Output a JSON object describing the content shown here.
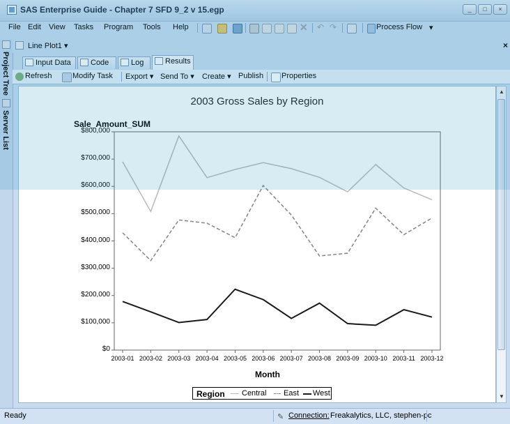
{
  "window": {
    "title": "SAS Enterprise Guide - Chapter 7 SFD 9_2 v 15.egp"
  },
  "menu": {
    "items": [
      "File",
      "Edit",
      "View",
      "Tasks",
      "Program",
      "Tools",
      "Help"
    ],
    "process_flow": "Process Flow"
  },
  "left_rail": {
    "project_tree": "Project Tree",
    "server_list": "Server List"
  },
  "document": {
    "title": "Line Plot1 ▾",
    "close": "×"
  },
  "tabs": [
    "Input Data",
    "Code",
    "Log",
    "Results"
  ],
  "results_toolbar": {
    "refresh": "Refresh",
    "modify_task": "Modify Task",
    "export": "Export ▾",
    "send_to": "Send To ▾",
    "create": "Create ▾",
    "publish": "Publish",
    "properties": "Properties"
  },
  "status": {
    "text": "Ready",
    "connection_label": "Connection:",
    "connection_value": "Freakalytics, LLC, stephen-pc"
  },
  "chart_data": {
    "type": "line",
    "title": "2003 Gross Sales by Region",
    "xlabel": "Month",
    "ylabel": "Sale_Amount_SUM",
    "categories": [
      "2003-01",
      "2003-02",
      "2003-03",
      "2003-04",
      "2003-05",
      "2003-06",
      "2003-07",
      "2003-08",
      "2003-09",
      "2003-10",
      "2003-11",
      "2003-12"
    ],
    "yticks": [
      "$0",
      "$100,000",
      "$200,000",
      "$300,000",
      "$400,000",
      "$500,000",
      "$600,000",
      "$700,000",
      "$800,000"
    ],
    "ylim": [
      0,
      800000
    ],
    "legend_title": "Region",
    "series": [
      {
        "name": "Central",
        "style": "solid",
        "color": "#bdbdbd",
        "values": [
          690000,
          508000,
          785000,
          632000,
          662000,
          687000,
          665000,
          633000,
          580000,
          680000,
          594000,
          551000
        ]
      },
      {
        "name": "East",
        "style": "dashed",
        "color": "#8a8a8a",
        "values": [
          430000,
          328000,
          477000,
          465000,
          412000,
          603000,
          495000,
          345000,
          355000,
          520000,
          423000,
          484000
        ]
      },
      {
        "name": "West",
        "style": "solid",
        "color": "#1a1a1a",
        "values": [
          178000,
          140000,
          101000,
          112000,
          223000,
          185000,
          116000,
          172000,
          97000,
          91000,
          148000,
          121000
        ]
      }
    ],
    "grid": false,
    "legend_position": "bottom"
  }
}
